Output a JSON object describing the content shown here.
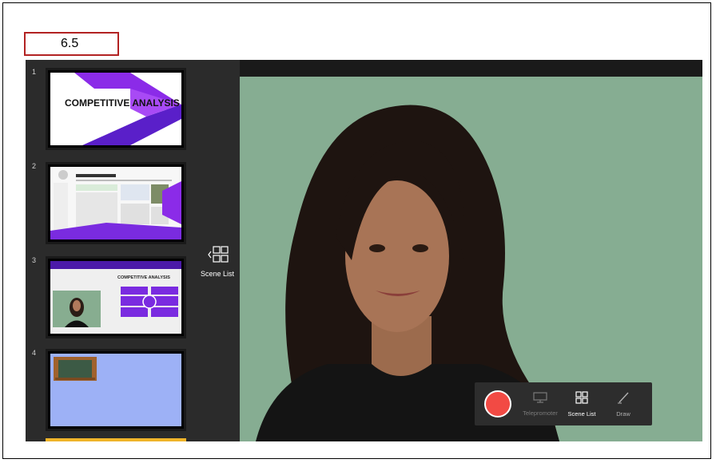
{
  "step_label": "6.5",
  "scenes": [
    {
      "number": "1",
      "title": "COMPETITIVE ANALYSIS"
    },
    {
      "number": "2"
    },
    {
      "number": "3",
      "title": "COMPETITIVE ANALYSIS"
    },
    {
      "number": "4"
    }
  ],
  "scene_list_toggle": {
    "label": "Scene List",
    "icon": "grid-icon"
  },
  "toolbar": {
    "record": {
      "icon": "record-icon"
    },
    "teleprompter": {
      "label": "Telepromoter",
      "icon": "monitor-icon"
    },
    "scene_list": {
      "label": "Scene List",
      "icon": "grid-icon"
    },
    "draw": {
      "label": "Draw",
      "icon": "pen-icon"
    }
  },
  "colors": {
    "record": "#f24a44",
    "backdrop": "#86ad92",
    "accent_purple": "#7a2be0"
  }
}
